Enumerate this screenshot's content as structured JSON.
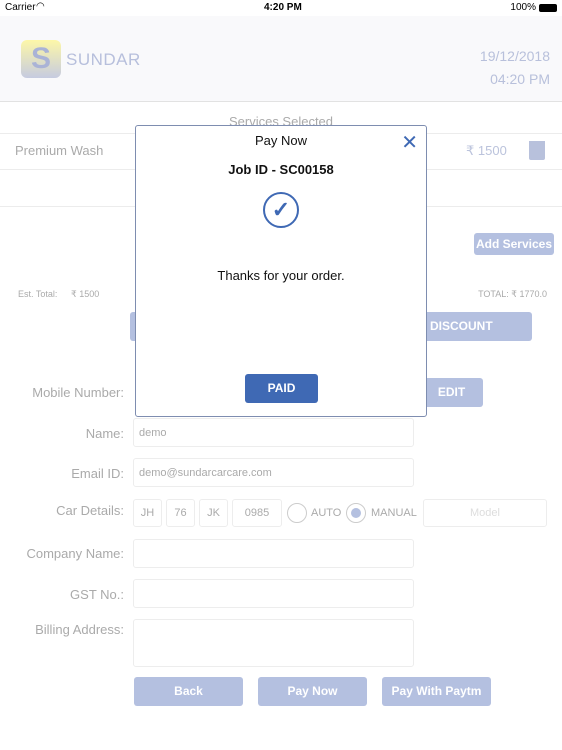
{
  "status_bar": {
    "carrier": "Carrier",
    "time": "4:20 PM",
    "battery": "100%"
  },
  "header": {
    "logo_letter": "S",
    "brand": "SUNDAR",
    "date": "19/12/2018",
    "time": "04:20 PM"
  },
  "services": {
    "title": "Services Selected",
    "items": [
      {
        "name": "Premium Wash",
        "price": "₹ 1500"
      }
    ],
    "add_label": "Add Services"
  },
  "totals": {
    "est_label": "Est. Total:",
    "est_value": "₹ 1500",
    "total": "TOTAL: ₹ 1770.0",
    "discount_label": "DISCOUNT"
  },
  "form": {
    "mobile_label": "Mobile Number:",
    "edit_label": "EDIT",
    "name_label": "Name:",
    "name_value": "demo",
    "email_label": "Email ID:",
    "email_value": "demo@sundarcarcare.com",
    "car_label": "Car Details:",
    "car": [
      "JH",
      "76",
      "JK",
      "0985"
    ],
    "auto_label": "AUTO",
    "manual_label": "MANUAL",
    "transmission": "MANUAL",
    "model_placeholder": "Model",
    "company_label": "Company Name:",
    "gst_label": "GST No.:",
    "billing_label": "Billing Address:"
  },
  "actions": {
    "back": "Back",
    "pay_now": "Pay Now",
    "paytm": "Pay With Paytm"
  },
  "modal": {
    "title": "Pay Now",
    "job_id": "Job ID - SC00158",
    "message": "Thanks for your order.",
    "paid_label": "PAID"
  },
  "colors": {
    "accent": "#3f69b4",
    "faded_button": "#b4c0e0"
  }
}
